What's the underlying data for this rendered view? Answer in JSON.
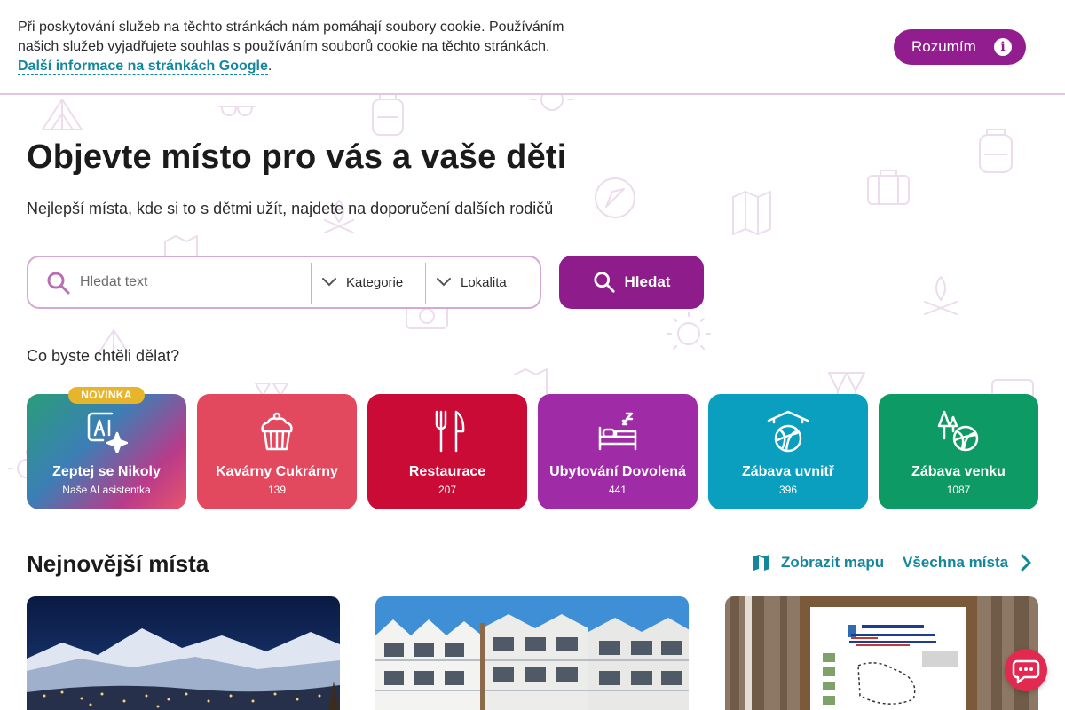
{
  "cookie": {
    "text": "Při poskytování služeb na těchto stránkách nám pomáhají soubory cookie. Používáním našich služeb vyjadřujete souhlas s používáním souborů cookie na těchto stránkách.",
    "link": "Další informace na stránkách Google",
    "link_suffix": ".",
    "button": "Rozumím",
    "info_glyph": "i"
  },
  "hero": {
    "title": "Objevte místo pro vás a vaše děti",
    "subtitle": "Nejlepší místa, kde si to s dětmi užít, najdete na doporučení dalších rodičů"
  },
  "search": {
    "placeholder": "Hledat text",
    "category": "Kategorie",
    "location": "Lokalita",
    "button": "Hledat"
  },
  "question": "Co byste chtěli dělat?",
  "categories": [
    {
      "label": "Zeptej se Nikoly",
      "count": "Naše AI asistentka",
      "badge": "NOVINKA",
      "icon": "ai-sparkle-icon"
    },
    {
      "label": "Kavárny Cukrárny",
      "count": "139",
      "icon": "cupcake-icon",
      "color": "#e2485e"
    },
    {
      "label": "Restaurace",
      "count": "207",
      "icon": "fork-knife-icon",
      "color": "#c90b36"
    },
    {
      "label": "Ubytování Dovolená",
      "count": "441",
      "icon": "bed-icon",
      "color": "#a02ba7"
    },
    {
      "label": "Zábava uvnitř",
      "count": "396",
      "icon": "indoor-ball-icon",
      "color": "#0a9fbe"
    },
    {
      "label": "Zábava venku",
      "count": "1087",
      "icon": "outdoor-ball-icon",
      "color": "#0e9a64"
    }
  ],
  "newest": {
    "title": "Nejnovější místa",
    "map_link": "Zobrazit mapu",
    "all_link": "Všechna místa"
  },
  "colors": {
    "primary": "#8e1d8b",
    "teal": "#14879b",
    "chat": "#e2294f"
  }
}
